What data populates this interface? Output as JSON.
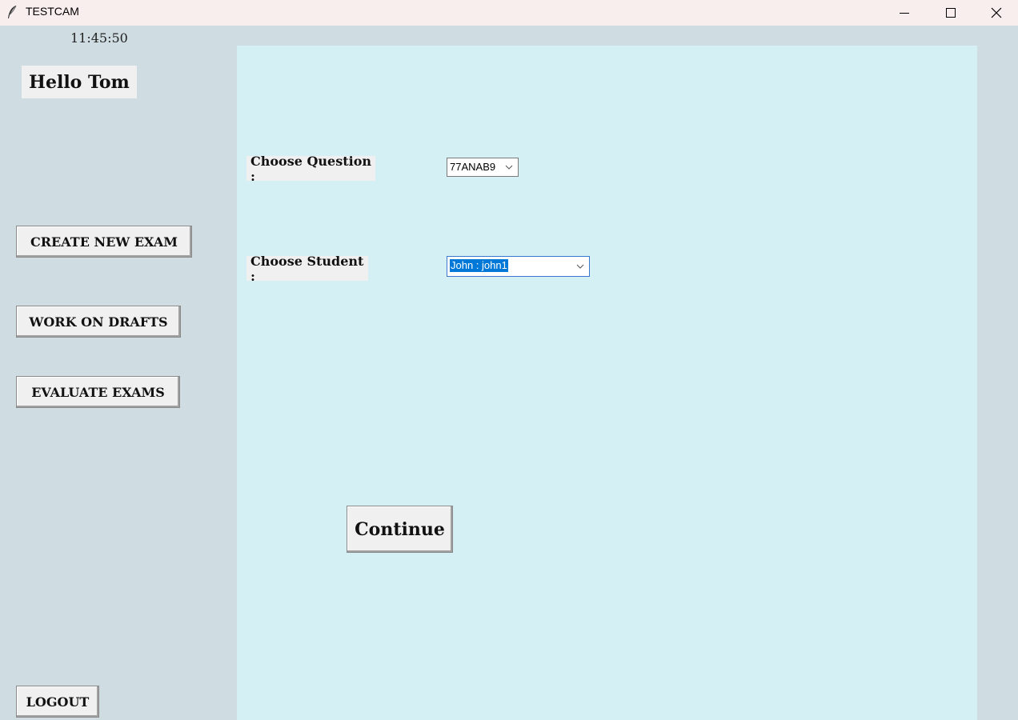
{
  "window": {
    "title": "TESTCAM",
    "icon": "feather-icon",
    "controls": [
      "minimize-icon",
      "maximize-icon",
      "close-icon"
    ]
  },
  "sidebar": {
    "clock": "11:45:50",
    "greeting": "Hello Tom",
    "buttons": {
      "create": "CREATE NEW EXAM",
      "drafts": "WORK ON DRAFTS",
      "evaluate": "EVALUATE EXAMS",
      "logout": "LOGOUT"
    }
  },
  "main": {
    "question_label": "Choose Question :",
    "question_value": "77ANAB9",
    "student_label": "Choose Student :",
    "student_value": "John : john1",
    "continue_label": "Continue"
  },
  "colors": {
    "titlebar": "#f9eeee",
    "sidebar_bg": "#cfdde2",
    "panel_bg": "#d5f0f5",
    "button_bg": "#f0f0f0",
    "selection": "#0078d7"
  }
}
